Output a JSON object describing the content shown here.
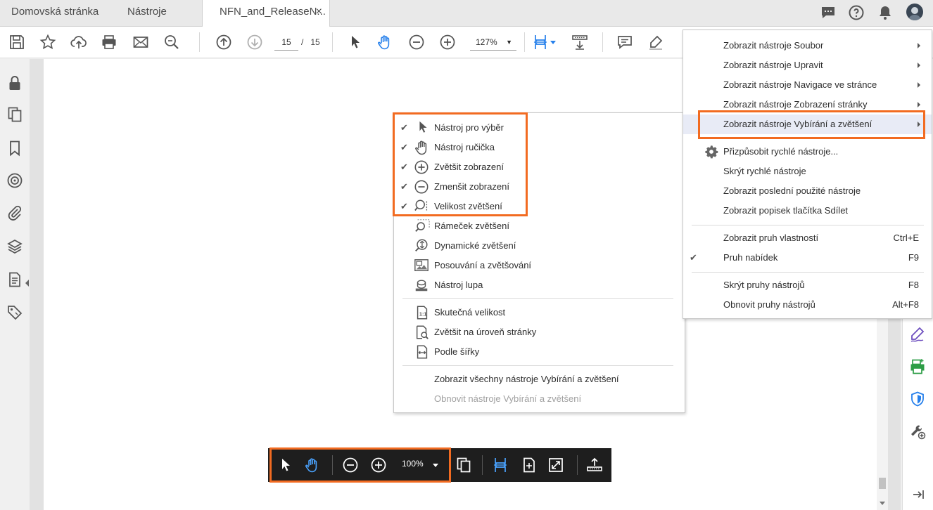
{
  "tabs": {
    "home": "Domovská stránka",
    "tools": "Nástroje",
    "document": "NFN_and_ReleaseN...",
    "close": "×"
  },
  "toolbar": {
    "page_current": "15",
    "page_separator": "/",
    "page_total": "15",
    "zoom": "127%"
  },
  "submenu": {
    "items": [
      {
        "label": "Nástroj pro výběr",
        "checked": true,
        "icon": "arrow-cursor-icon"
      },
      {
        "label": "Nástroj ručička",
        "checked": true,
        "icon": "hand-icon"
      },
      {
        "label": "Zvětšit zobrazení",
        "checked": true,
        "icon": "zoom-in-icon"
      },
      {
        "label": "Zmenšit zobrazení",
        "checked": true,
        "icon": "zoom-out-icon"
      },
      {
        "label": "Velikost zvětšení",
        "checked": true,
        "icon": "zoom-level-icon"
      },
      {
        "label": "Rámeček zvětšení",
        "checked": false,
        "icon": "marquee-zoom-icon"
      },
      {
        "label": "Dynamické zvětšení",
        "checked": false,
        "icon": "dynamic-zoom-icon"
      },
      {
        "label": "Posouvání a zvětšování",
        "checked": false,
        "icon": "pan-zoom-icon"
      },
      {
        "label": "Nástroj lupa",
        "checked": false,
        "icon": "loupe-icon"
      },
      {
        "label": "Skutečná velikost",
        "checked": false,
        "icon": "actual-size-icon"
      },
      {
        "label": "Zvětšit na úroveň stránky",
        "checked": false,
        "icon": "fit-page-icon"
      },
      {
        "label": "Podle šířky",
        "checked": false,
        "icon": "fit-width-icon"
      }
    ],
    "show_all": "Zobrazit všechny nástroje Vybírání a zvětšení",
    "reset": "Obnovit nástroje Vybírání a zvětšení"
  },
  "context_menu": {
    "items": [
      {
        "label": "Zobrazit nástroje Soubor"
      },
      {
        "label": "Zobrazit nástroje Upravit"
      },
      {
        "label": "Zobrazit nástroje Navigace ve stránce"
      },
      {
        "label": "Zobrazit nástroje Zobrazení stránky"
      },
      {
        "label": "Zobrazit nástroje Vybírání a zvětšení"
      }
    ],
    "customize": "Přizpůsobit rychlé nástroje...",
    "hide_quick": "Skrýt rychlé nástroje",
    "recent": "Zobrazit poslední použité nástroje",
    "share_label": "Zobrazit popisek tlačítka Sdílet",
    "properties": "Zobrazit pruh vlastností",
    "properties_sc": "Ctrl+E",
    "menubar": "Pruh nabídek",
    "menubar_sc": "F9",
    "hide_toolbars": "Skrýt pruhy nástrojů",
    "hide_toolbars_sc": "F8",
    "reset_toolbars": "Obnovit pruhy nástrojů",
    "reset_toolbars_sc": "Alt+F8"
  },
  "floating_toolbar": {
    "zoom": "100%"
  },
  "colors": {
    "accent_blue": "#2680eb",
    "highlight_orange": "#f26b21",
    "sign_purple": "#6e4fbf",
    "export_green": "#2d9d46"
  }
}
